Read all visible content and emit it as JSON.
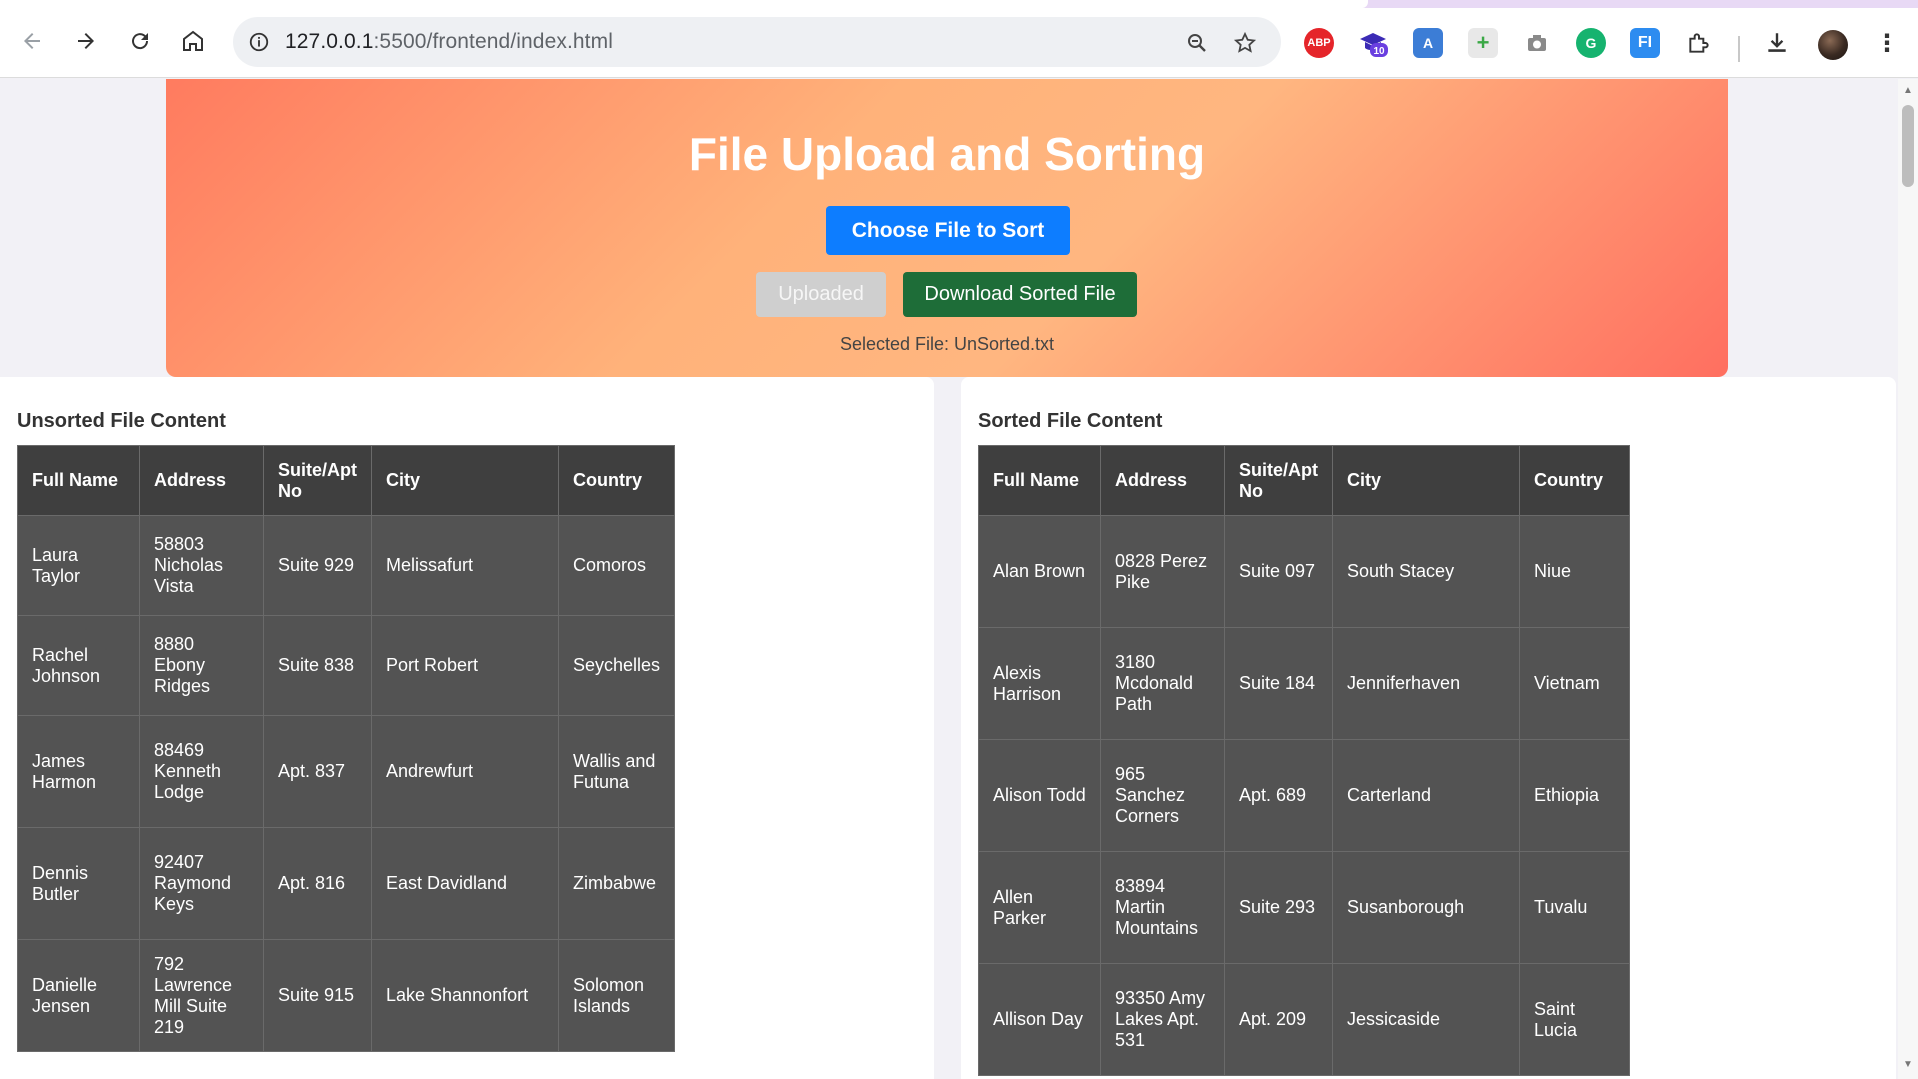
{
  "browser": {
    "url_host": "127.0.0.1",
    "url_path": ":5500/frontend/index.html",
    "extension_badge": "10",
    "extensions": [
      "abp-icon",
      "graduation-cap-icon",
      "font-icon",
      "add-photo-icon",
      "camera-icon",
      "grammarly-icon",
      "fi-icon",
      "puzzle-icon"
    ]
  },
  "hero": {
    "title": "File Upload and Sorting",
    "choose_button": "Choose File to Sort",
    "uploaded_button": "Uploaded",
    "download_button": "Download Sorted File",
    "selected_file": "Selected File: UnSorted.txt"
  },
  "unsorted": {
    "heading": "Unsorted File Content",
    "columns": [
      "Full Name",
      "Address",
      "Suite/Apt No",
      "City",
      "Country"
    ],
    "rows": [
      [
        "Laura Taylor",
        "58803 Nicholas Vista",
        "Suite 929",
        "Melissafurt",
        "Comoros"
      ],
      [
        "Rachel Johnson",
        "8880 Ebony Ridges",
        "Suite 838",
        "Port Robert",
        "Seychelles"
      ],
      [
        "James Harmon",
        "88469 Kenneth Lodge",
        "Apt. 837",
        "Andrewfurt",
        "Wallis and Futuna"
      ],
      [
        "Dennis Butler",
        "92407 Raymond Keys",
        "Apt. 816",
        "East Davidland",
        "Zimbabwe"
      ],
      [
        "Danielle Jensen",
        "792 Lawrence Mill Suite 219",
        "Suite 915",
        "Lake Shannonfort",
        "Solomon Islands"
      ]
    ]
  },
  "sorted": {
    "heading": "Sorted File Content",
    "columns": [
      "Full Name",
      "Address",
      "Suite/Apt No",
      "City",
      "Country"
    ],
    "rows": [
      [
        "Alan Brown",
        "0828 Perez Pike",
        "Suite 097",
        "South Stacey",
        "Niue"
      ],
      [
        "Alexis Harrison",
        "3180 Mcdonald Path",
        "Suite 184",
        "Jenniferhaven",
        "Vietnam"
      ],
      [
        "Alison Todd",
        "965 Sanchez Corners",
        "Apt. 689",
        "Carterland",
        "Ethiopia"
      ],
      [
        "Allen Parker",
        "83894 Martin Mountains",
        "Suite 293",
        "Susanborough",
        "Tuvalu"
      ],
      [
        "Allison Day",
        "93350 Amy Lakes Apt. 531",
        "Apt. 209",
        "Jessicaside",
        "Saint Lucia"
      ]
    ]
  }
}
